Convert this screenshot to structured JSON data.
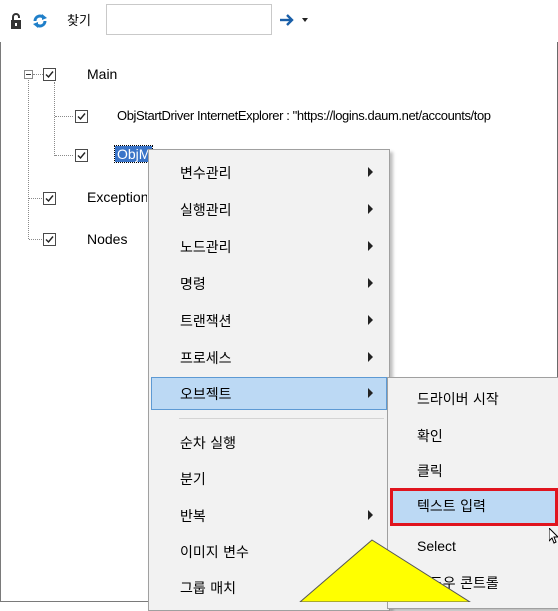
{
  "toolbar": {
    "find_label": "찾기",
    "search_value": ""
  },
  "tree": {
    "root_label": "Main",
    "nodes": [
      {
        "label": "ObjStartDriver InternetExplorer : \"https://logins.daum.net/accounts/top"
      },
      {
        "label": "ObjMail"
      },
      {
        "label": "Exceptions"
      },
      {
        "label": "Nodes"
      }
    ],
    "visible_selected": "ObjM"
  },
  "context_menu": {
    "items": [
      {
        "label": "변수관리",
        "submenu": true
      },
      {
        "label": "실행관리",
        "submenu": true
      },
      {
        "label": "노드관리",
        "submenu": true
      },
      {
        "label": "명령",
        "submenu": true
      },
      {
        "label": "트랜잭션",
        "submenu": true
      },
      {
        "label": "프로세스",
        "submenu": true
      },
      {
        "label": "오브젝트",
        "submenu": true,
        "highlighted": true
      },
      {
        "label": "순차 실행",
        "submenu": false
      },
      {
        "label": "분기",
        "submenu": false
      },
      {
        "label": "반복",
        "submenu": true
      },
      {
        "label": "이미지 변수",
        "submenu": true
      },
      {
        "label": "그룹 매치",
        "submenu": false
      }
    ]
  },
  "object_submenu": {
    "items": [
      {
        "label": "드라이버 시작"
      },
      {
        "label": "확인"
      },
      {
        "label": "클릭"
      },
      {
        "label": "텍스트 입력",
        "highlighted": true
      },
      {
        "label": "Select"
      },
      {
        "label": "윈도우 콘트롤"
      }
    ]
  },
  "colors": {
    "selection": "#3a74c8",
    "menu_hover": "#bcd9f4",
    "annotation_border": "#e0141e",
    "callout": "#ffff00"
  }
}
